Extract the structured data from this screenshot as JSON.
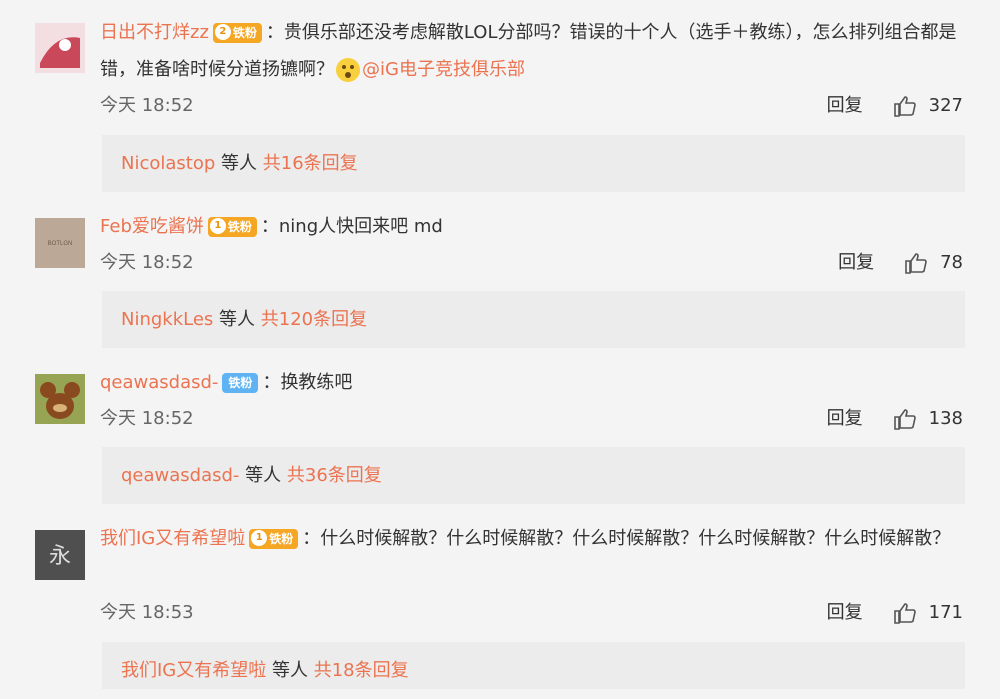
{
  "comments": [
    {
      "username": "日出不打烊zz",
      "badge_level": "2",
      "badge_label": "铁粉",
      "colon": "：",
      "text": "贵俱乐部还没考虑解散LOL分部吗？错误的十个人（选手＋教练），怎么排列组合都是错，准备啥时候分道扬镳啊？",
      "mention": "@iG电子竞技俱乐部",
      "time": "今天 18:52",
      "reply_label": "回复",
      "likes": "327",
      "replies": {
        "replier": "Nicolastop",
        "middle": "等人",
        "summary": "共16条回复"
      }
    },
    {
      "username": "Feb爱吃酱饼",
      "badge_level": "1",
      "badge_label": "铁粉",
      "colon": "：",
      "text": "ning人快回来吧 md",
      "avatar_text": "BOTLGN",
      "time": "今天 18:52",
      "reply_label": "回复",
      "likes": "78",
      "replies": {
        "replier": "NingkkLes",
        "middle": "等人",
        "summary": "共120条回复"
      }
    },
    {
      "username": "qeawasdasd-",
      "badge_label": "铁粉",
      "colon": "：",
      "text": "换教练吧",
      "time": "今天 18:52",
      "reply_label": "回复",
      "likes": "138",
      "replies": {
        "replier": "qeawasdasd-",
        "middle": "等人",
        "summary": "共36条回复"
      }
    },
    {
      "username": "我们IG又有希望啦",
      "badge_level": "1",
      "badge_label": "铁粉",
      "colon": "：",
      "text": "什么时候解散？什么时候解散？什么时候解散？什么时候解散？什么时候解散？",
      "avatar_text": "永",
      "time": "今天 18:53",
      "reply_label": "回复",
      "likes": "171",
      "replies": {
        "replier": "我们IG又有希望啦",
        "middle": "等人",
        "summary": "共18条回复"
      }
    }
  ],
  "colors": {
    "accent": "#eb7350",
    "badge": "#f5a623",
    "badge_blue": "#5fb3f2",
    "reply_bg": "#ececec"
  },
  "icons": {
    "like": "thumbs-up-icon",
    "emoji": "surprised-face-icon",
    "crown": "crown-badge-icon"
  }
}
